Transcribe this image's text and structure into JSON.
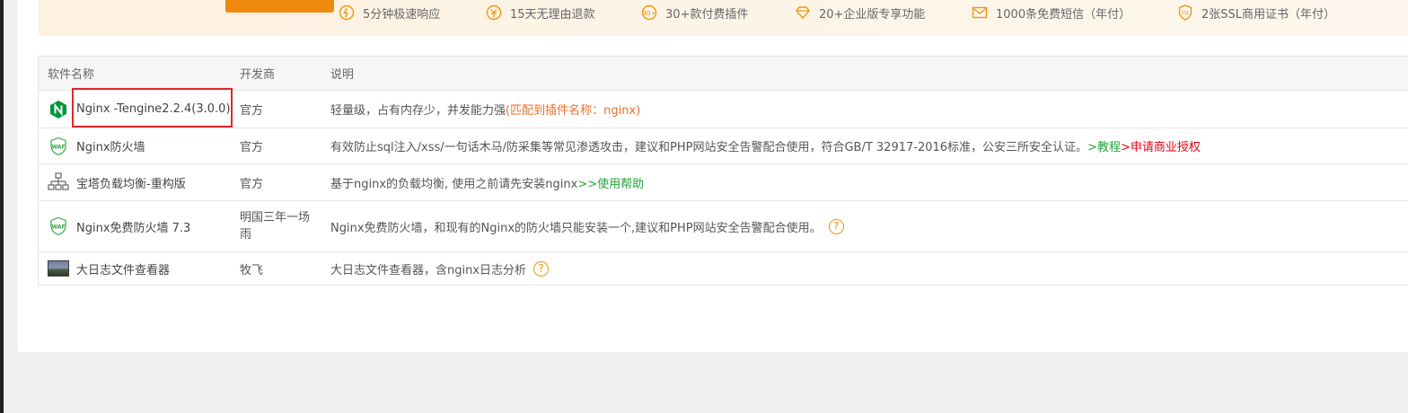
{
  "promo": {
    "perks": [
      {
        "icon": "clock-lightning-icon",
        "label": "5分钟极速响应"
      },
      {
        "icon": "refund-icon",
        "label": "15天无理由退款"
      },
      {
        "icon": "plugin-30-icon",
        "label": "30+款付费插件"
      },
      {
        "icon": "diamond-icon",
        "label": "20+企业版专享功能"
      },
      {
        "icon": "mail-icon",
        "label": "1000条免费短信（年付）"
      },
      {
        "icon": "ssl-shield-icon",
        "label": "2张SSL商用证书（年付）"
      }
    ],
    "accent": "#f08a0f"
  },
  "table": {
    "headers": {
      "name": "软件名称",
      "developer": "开发商",
      "description": "说明"
    },
    "rows": [
      {
        "icon": "nginx-icon",
        "name": "Nginx -Tengine2.2.4(3.0.0)",
        "developer": "官方",
        "description": "轻量级，占有内存少，并发能力强",
        "match": "(匹配到插件名称：nginx)"
      },
      {
        "icon": "waf-shield-icon",
        "name": "Nginx防火墙",
        "developer": "官方",
        "description": "有效防止sql注入/xss/一句话木马/防采集等常见渗透攻击，建议和PHP网站安全告警配合使用，符合GB/T 32917-2016标准，公安三所安全认证。",
        "link1": ">教程",
        "link2": ">申请商业授权"
      },
      {
        "icon": "load-balance-icon",
        "name": "宝塔负载均衡-重构版",
        "developer": "官方",
        "description": "基于nginx的负载均衡, 使用之前请先安装nginx",
        "link1": ">>使用帮助"
      },
      {
        "icon": "waf-shield-icon",
        "name": "Nginx免费防火墙 7.3",
        "developer": "明国三年一场雨",
        "description": "Nginx免费防火墙，和现有的Nginx的防火墙只能安装一个,建议和PHP网站安全告警配合使用。",
        "help": "?"
      },
      {
        "icon": "log-viewer-thumbnail",
        "name": "大日志文件查看器",
        "developer": "牧飞",
        "description": "大日志文件查看器，含nginx日志分析",
        "help": "?"
      }
    ]
  }
}
